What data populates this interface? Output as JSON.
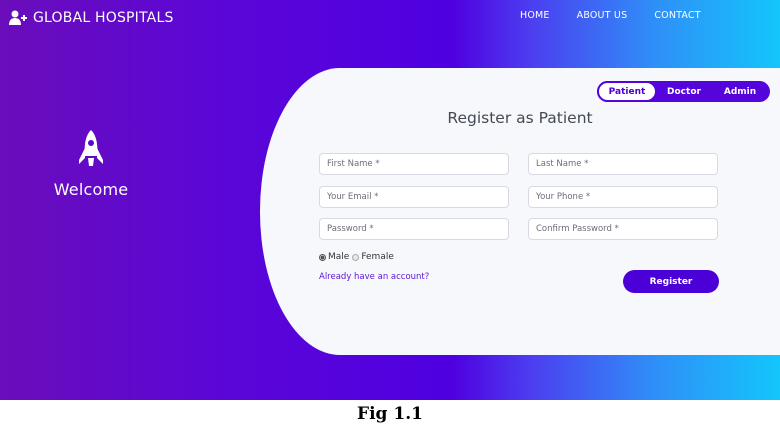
{
  "header": {
    "brand_icon": "add-user-icon",
    "brand_title": "GLOBAL HOSPITALS",
    "nav": [
      "HOME",
      "ABOUT US",
      "CONTACT"
    ]
  },
  "left_panel": {
    "icon": "rocket-icon",
    "welcome_text": "Welcome"
  },
  "tabs": [
    "Patient",
    "Doctor",
    "Admin"
  ],
  "active_tab": "Patient",
  "form": {
    "title": "Register as Patient",
    "first_name_placeholder": "First Name *",
    "last_name_placeholder": "Last Name *",
    "email_placeholder": "Your Email *",
    "phone_placeholder": "Your Phone *",
    "password_placeholder": "Password *",
    "confirm_password_placeholder": "Confirm Password *",
    "gender_options": [
      "Male",
      "Female"
    ],
    "gender_selected": "Male",
    "login_link": "Already have an account?",
    "submit_label": "Register"
  },
  "caption": "Fig 1.1",
  "colors": {
    "accent": "#4c00d8",
    "gradient_start": "#6a0dbb",
    "gradient_end": "#13c6fb",
    "card_background": "#f7f8fb"
  }
}
